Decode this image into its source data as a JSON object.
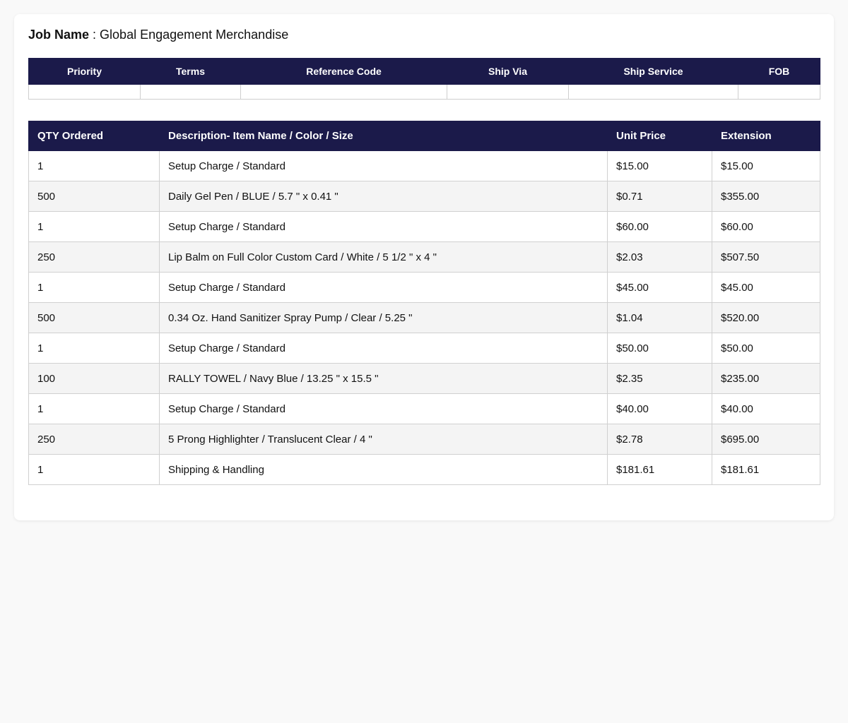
{
  "job": {
    "label": "Job Name",
    "separator": " : ",
    "value": "Global Engagement Merchandise"
  },
  "shipping": {
    "headers": [
      "Priority",
      "Terms",
      "Reference Code",
      "Ship Via",
      "Ship Service",
      "FOB"
    ],
    "values": [
      "",
      "",
      "",
      "",
      "",
      ""
    ]
  },
  "items": {
    "headers": [
      "QTY Ordered",
      "Description- Item Name / Color / Size",
      "Unit Price",
      "Extension"
    ],
    "rows": [
      [
        "1",
        "Setup Charge / Standard",
        "$15.00",
        "$15.00"
      ],
      [
        "500",
        "Daily Gel Pen / BLUE / 5.7 \" x 0.41 \"",
        "$0.71",
        "$355.00"
      ],
      [
        "1",
        "Setup Charge / Standard",
        "$60.00",
        "$60.00"
      ],
      [
        "250",
        "Lip Balm on Full Color Custom Card / White / 5 1/2 \" x 4 \"",
        "$2.03",
        "$507.50"
      ],
      [
        "1",
        "Setup Charge / Standard",
        "$45.00",
        "$45.00"
      ],
      [
        "500",
        "0.34 Oz. Hand Sanitizer Spray Pump / Clear / 5.25 \"",
        "$1.04",
        "$520.00"
      ],
      [
        "1",
        "Setup Charge / Standard",
        "$50.00",
        "$50.00"
      ],
      [
        "100",
        "RALLY TOWEL / Navy Blue / 13.25 \" x 15.5 \"",
        "$2.35",
        "$235.00"
      ],
      [
        "1",
        "Setup Charge / Standard",
        "$40.00",
        "$40.00"
      ],
      [
        "250",
        "5 Prong Highlighter / Translucent Clear / 4 \"",
        "$2.78",
        "$695.00"
      ],
      [
        "1",
        "Shipping & Handling",
        "$181.61",
        "$181.61"
      ]
    ]
  },
  "colors": {
    "header_bg": "#1b1a4a",
    "header_text": "#ffffff",
    "row_alt": "#f4f4f4",
    "page_bg": "#f9f9f9"
  }
}
